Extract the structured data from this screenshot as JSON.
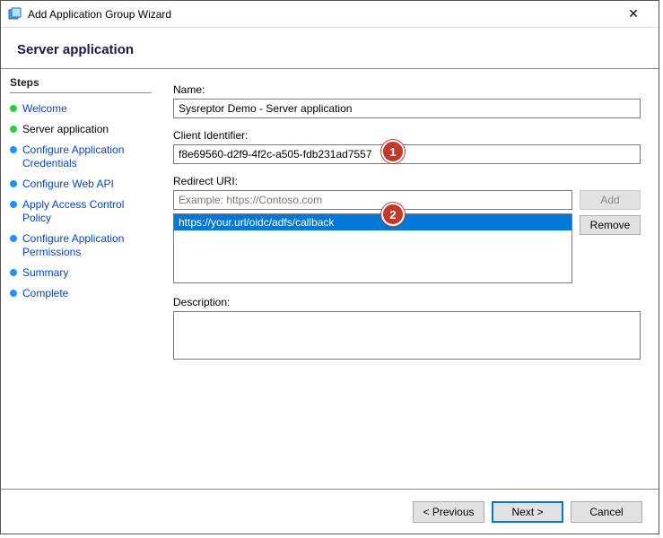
{
  "window": {
    "title": "Add Application Group Wizard",
    "close_label": "✕"
  },
  "header": {
    "title": "Server application"
  },
  "sidebar": {
    "title": "Steps",
    "items": [
      {
        "label": "Welcome",
        "state": "done"
      },
      {
        "label": "Server application",
        "state": "done",
        "current": true
      },
      {
        "label": "Configure Application Credentials",
        "state": "todo"
      },
      {
        "label": "Configure Web API",
        "state": "todo"
      },
      {
        "label": "Apply Access Control Policy",
        "state": "todo"
      },
      {
        "label": "Configure Application Permissions",
        "state": "todo"
      },
      {
        "label": "Summary",
        "state": "todo"
      },
      {
        "label": "Complete",
        "state": "todo"
      }
    ]
  },
  "form": {
    "name_label": "Name:",
    "name_value": "Sysreptor Demo - Server application",
    "client_id_label": "Client Identifier:",
    "client_id_value": "f8e69560-d2f9-4f2c-a505-fdb231ad7557",
    "redirect_label": "Redirect URI:",
    "redirect_placeholder": "Example: https://Contoso.com",
    "redirect_value": "",
    "uri_list": [
      "https://your.url/oidc/adfs/callback"
    ],
    "add_button": "Add",
    "remove_button": "Remove",
    "description_label": "Description:",
    "description_value": ""
  },
  "footer": {
    "previous": "< Previous",
    "next": "Next >",
    "cancel": "Cancel"
  },
  "annotations": {
    "one": "1",
    "two": "2"
  }
}
